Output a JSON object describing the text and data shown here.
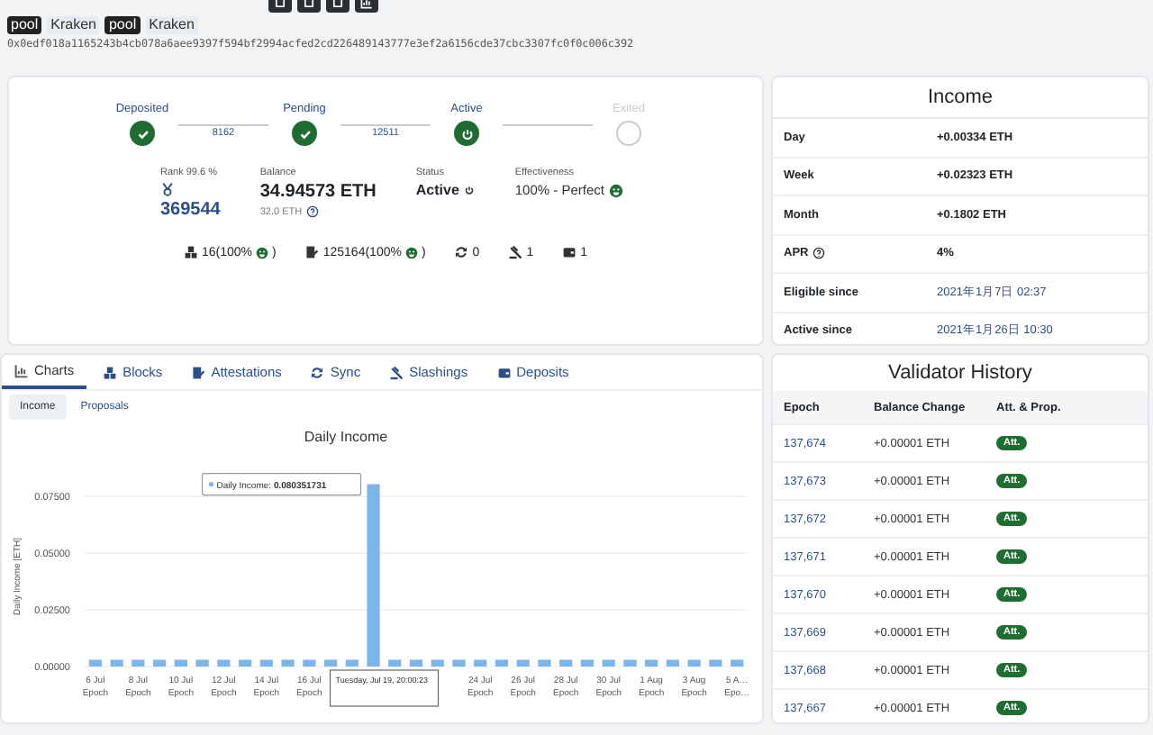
{
  "header": {
    "buttons": [
      {
        "kind": "square"
      },
      {
        "kind": "square"
      },
      {
        "kind": "square"
      },
      {
        "kind": "chart"
      }
    ],
    "tags": [
      {
        "kind": "dark",
        "label": "pool"
      },
      {
        "kind": "light",
        "label": "Kraken"
      },
      {
        "kind": "dark",
        "label": "pool"
      },
      {
        "kind": "light",
        "label": "Kraken"
      }
    ],
    "address": "0x0edf018a1165243b4cb078a6aee9397f594bf2994acfed2cd226489143777e3ef2a6156cde37cbc3307fc0f0c006c392"
  },
  "lifecycle": {
    "steps": [
      {
        "label": "Deposited",
        "kind": "done"
      },
      {
        "label": "Pending",
        "kind": "done"
      },
      {
        "label": "Active",
        "kind": "active"
      },
      {
        "label": "Exited",
        "kind": "future"
      }
    ],
    "connectors": [
      "8162",
      "12511"
    ]
  },
  "stats": [
    {
      "kind": "rank",
      "label": "Rank 99.6 %",
      "value": "369544"
    },
    {
      "kind": "balance",
      "label": "Balance",
      "value": "34.94573 ETH",
      "sub": "32.0 ETH"
    },
    {
      "kind": "status",
      "label": "Status",
      "value": "Active"
    },
    {
      "kind": "effectiveness",
      "label": "Effectiveness",
      "value": "100% - Perfect"
    }
  ],
  "counters": [
    {
      "kind": "blocks",
      "text": "16(100%",
      "suffix": ")"
    },
    {
      "kind": "attestations",
      "text": "125164(100%",
      "suffix": ")"
    },
    {
      "kind": "sync",
      "text": "0"
    },
    {
      "kind": "slashings",
      "text": "1"
    },
    {
      "kind": "deposits",
      "text": "1"
    }
  ],
  "income": {
    "title": "Income",
    "rows": [
      {
        "label": "Day",
        "value": "+0.00334 ETH",
        "kind": "eth"
      },
      {
        "label": "Week",
        "value": "+0.02323 ETH",
        "kind": "eth"
      },
      {
        "label": "Month",
        "value": "+0.1802 ETH",
        "kind": "eth"
      },
      {
        "label": "APR",
        "value": "4%",
        "kind": "apr"
      },
      {
        "label": "Eligible since",
        "value": "2021年1月7日 02:37",
        "kind": "date"
      },
      {
        "label": "Active since",
        "value": "2021年1月26日 10:30",
        "kind": "date"
      }
    ]
  },
  "tabs": [
    {
      "kind": "charts",
      "label": "Charts",
      "selected": true
    },
    {
      "kind": "blocks",
      "label": "Blocks",
      "selected": false
    },
    {
      "kind": "attestations",
      "label": "Attestations",
      "selected": false
    },
    {
      "kind": "sync",
      "label": "Sync",
      "selected": false
    },
    {
      "kind": "slashings",
      "label": "Slashings",
      "selected": false
    },
    {
      "kind": "deposits",
      "label": "Deposits",
      "selected": false
    }
  ],
  "subtabs": [
    {
      "label": "Income",
      "selected": true
    },
    {
      "label": "Proposals",
      "selected": false
    }
  ],
  "chart_data": {
    "type": "bar",
    "title": "Daily Income",
    "ylabel": "Daily Income [ETH]",
    "categories": [
      "6 Jul\nEpoch",
      null,
      "8 Jul\nEpoch",
      null,
      "10 Jul\nEpoch",
      null,
      "12 Jul\nEpoch",
      null,
      "14 Jul\nEpoch",
      null,
      "16 Jul\nEpoch",
      null,
      null,
      null,
      null,
      null,
      null,
      null,
      "24 Jul\nEpoch",
      null,
      "26 Jul\nEpoch",
      null,
      "28 Jul\nEpoch",
      null,
      "30 Jul\nEpoch",
      null,
      "1 Aug\nEpoch",
      null,
      "3 Aug\nEpoch",
      null,
      "5 A…\nEpo…"
    ],
    "series": [
      {
        "color": "#7cb5ec",
        "values": [
          0.003,
          0.003,
          0.003,
          0.003,
          0.003,
          0.003,
          0.003,
          0.003,
          0.003,
          0.003,
          0.003,
          0.003,
          0.003,
          0.0804,
          0.003,
          0.003,
          0.003,
          0.003,
          0.003,
          0.003,
          0.003,
          0.003,
          0.003,
          0.003,
          0.003,
          0.003,
          0.003,
          0.003,
          0.003,
          0.003,
          0.003
        ]
      }
    ],
    "ylim": [
      0,
      0.085
    ],
    "grid": true,
    "yticks": [
      {
        "value": 0,
        "label": "0.00000"
      },
      {
        "value": 0.025,
        "label": "0.02500"
      },
      {
        "value": 0.05,
        "label": "0.05000"
      },
      {
        "value": 0.075,
        "label": "0.07500"
      }
    ],
    "annotations": [
      "Daily Income: **0.080351731**",
      "Tuesday, Jul 19, 20:00:23"
    ]
  },
  "history": {
    "title": "Validator History",
    "columns": [
      "Epoch",
      "Balance Change",
      "Att. & Prop."
    ],
    "rows": [
      [
        "137,674",
        "+0.00001 ETH",
        "Att."
      ],
      [
        "137,673",
        "+0.00001 ETH",
        "Att."
      ],
      [
        "137,672",
        "+0.00001 ETH",
        "Att."
      ],
      [
        "137,671",
        "+0.00001 ETH",
        "Att."
      ],
      [
        "137,670",
        "+0.00001 ETH",
        "Att."
      ],
      [
        "137,669",
        "+0.00001 ETH",
        "Att."
      ],
      [
        "137,668",
        "+0.00001 ETH",
        "Att."
      ],
      [
        "137,667",
        "+0.00001 ETH",
        "Att."
      ]
    ]
  }
}
